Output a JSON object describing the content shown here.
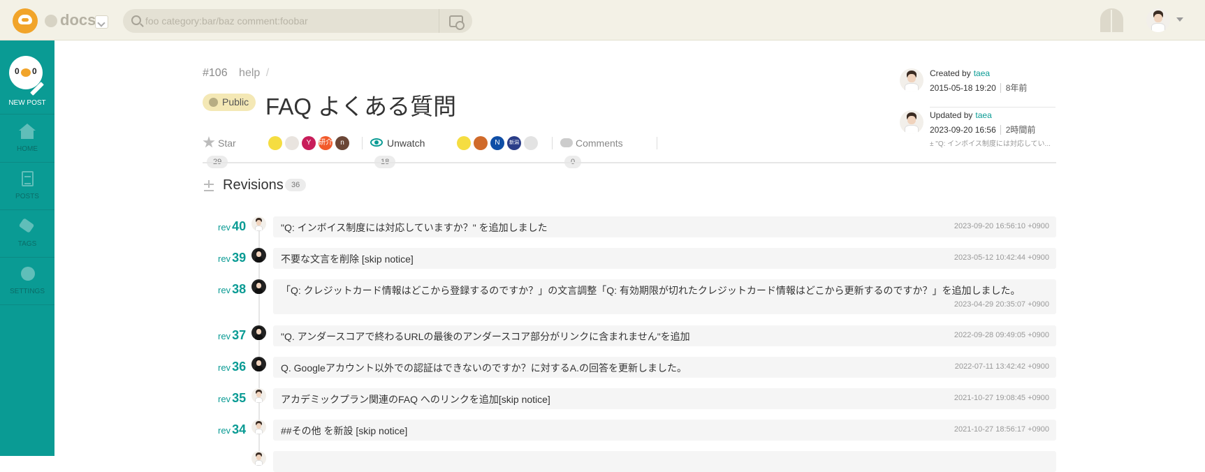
{
  "header": {
    "team_name": "docs",
    "search_placeholder": "foo category:bar/baz comment:foobar"
  },
  "sidebar": {
    "new_post": {
      "count_left": "0",
      "count_right": "0",
      "label": "NEW POST"
    },
    "items": [
      {
        "label": "HOME"
      },
      {
        "label": "POSTS"
      },
      {
        "label": "TAGS"
      },
      {
        "label": "SETTINGS"
      }
    ]
  },
  "post": {
    "number": "#106",
    "category": "help",
    "separator": "/",
    "visibility": "Public",
    "title": "FAQ よくある質問",
    "star_label": "Star",
    "star_count": "29",
    "watch_label": "Unwatch",
    "watch_count": "18",
    "comments_label": "Comments",
    "comments_count": "0",
    "stargazers": [
      {
        "initial": "",
        "color": "#f5dd41"
      },
      {
        "initial": "",
        "color": "#e9e4df"
      },
      {
        "initial": "Y",
        "color": "#c81d5a"
      },
      {
        "initial": "研介",
        "color": "#f25a2a"
      },
      {
        "initial": "n",
        "color": "#6b4636"
      }
    ],
    "watchers": [
      {
        "initial": "",
        "color": "#f5dd41"
      },
      {
        "initial": "",
        "color": "#d06a2a"
      },
      {
        "initial": "N",
        "color": "#0e4ea6"
      },
      {
        "initial": "新潟",
        "color": "#2a3d88"
      },
      {
        "initial": "",
        "color": "#e3e3e3"
      }
    ]
  },
  "meta": {
    "created_label": "Created by",
    "created_user": "taea",
    "created_at": "2015-05-18 19:20",
    "created_ago": "8年前",
    "updated_label": "Updated by",
    "updated_user": "taea",
    "updated_at": "2023-09-20 16:56",
    "updated_ago": "2時間前",
    "updated_message": "± \"Q: インボイス制度には対応してい..."
  },
  "revisions": {
    "title": "Revisions",
    "count": "36",
    "rev_prefix": "rev",
    "items": [
      {
        "rev": "40",
        "avatar": "light",
        "message": "\"Q: インボイス制度には対応していますか？\" を追加しました",
        "date": "2023-09-20 16:56:10 +0900"
      },
      {
        "rev": "39",
        "avatar": "dark",
        "message": "不要な文言を削除 [skip notice]",
        "date": "2023-05-12 10:42:44 +0900"
      },
      {
        "rev": "38",
        "avatar": "dark",
        "message": "「Q: クレジットカード情報はどこから登録するのですか？」の文言調整「Q: 有効期限が切れたクレジットカード情報はどこから更新するのですか？」を追加しました。",
        "date": "2023-04-29 20:35:07 +0900"
      },
      {
        "rev": "37",
        "avatar": "dark",
        "message": "\"Q. アンダースコアで終わるURLの最後のアンダースコア部分がリンクに含まれません\"を追加",
        "date": "2022-09-28 09:49:05 +0900"
      },
      {
        "rev": "36",
        "avatar": "dark",
        "message": "Q. Googleアカウント以外での認証はできないのですか？に対するA.の回答を更新しました。",
        "date": "2022-07-11 13:42:42 +0900"
      },
      {
        "rev": "35",
        "avatar": "light",
        "message": "アカデミックプラン関連のFAQ へのリンクを追加[skip notice]",
        "date": "2021-10-27 19:08:45 +0900"
      },
      {
        "rev": "34",
        "avatar": "light",
        "message": "##その他 を新設 [skip notice]",
        "date": "2021-10-27 18:56:17 +0900"
      }
    ]
  }
}
